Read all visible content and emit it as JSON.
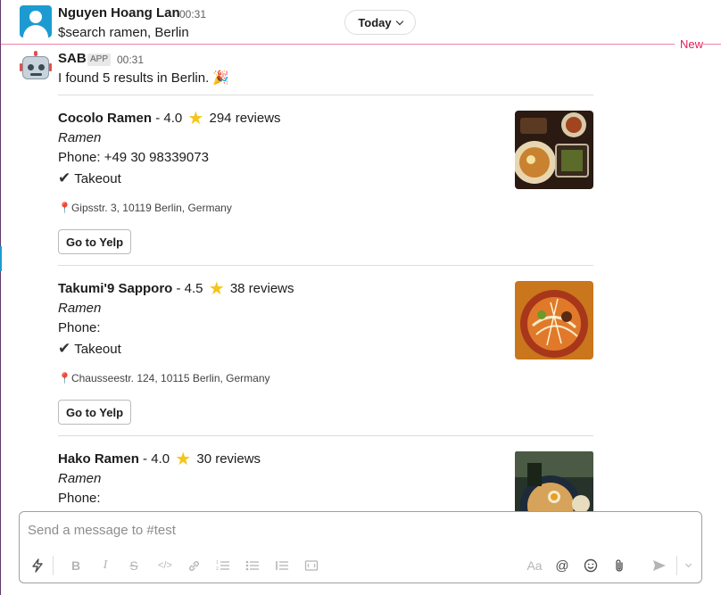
{
  "day_divider": {
    "label": "Today",
    "new_label": "New"
  },
  "user_message": {
    "sender": "Nguyen Hoang Lan",
    "time": "00:31",
    "text": "$search ramen, Berlin"
  },
  "bot_message": {
    "sender": "SAB",
    "badge": "APP",
    "time": "00:31",
    "text": "I found 5 results in Berlin. 🎉"
  },
  "results": [
    {
      "name": "Cocolo Ramen",
      "rating": "4.0",
      "reviews": "294 reviews",
      "category": "Ramen",
      "phone": "Phone: +49 30 98339073",
      "takeout": "Takeout",
      "address": "Gipsstr. 3, 10119 Berlin, Germany",
      "button": "Go to Yelp"
    },
    {
      "name": "Takumi'9 Sapporo",
      "rating": "4.5",
      "reviews": "38 reviews",
      "category": "Ramen",
      "phone": "Phone:",
      "takeout": "Takeout",
      "address": "Chausseestr. 124, 10115 Berlin, Germany",
      "button": "Go to Yelp"
    },
    {
      "name": "Hako Ramen",
      "rating": "4.0",
      "reviews": "30 reviews",
      "category": "Ramen",
      "phone": "Phone:"
    }
  ],
  "composer": {
    "placeholder": "Send a message to #test",
    "format_label": "Aa",
    "mention_label": "@"
  },
  "colors": {
    "new_line": "#e01e5a",
    "star": "#f5c518",
    "avatar": "#1d9bd1"
  }
}
